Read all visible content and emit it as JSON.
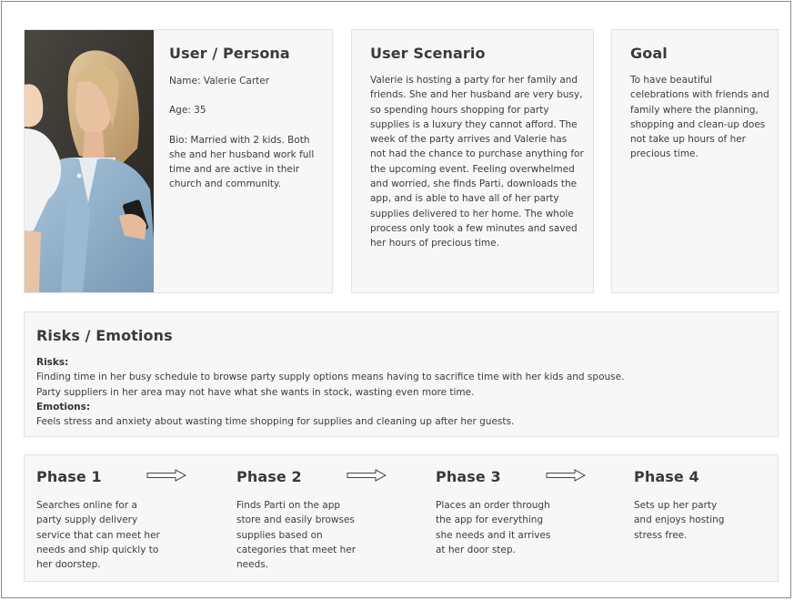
{
  "persona": {
    "title": "User / Persona",
    "name": "Name: Valerie Carter",
    "age": "Age: 35",
    "bio": "Bio: Married with 2 kids. Both she and her husband work full time and are active in their church and community."
  },
  "scenario": {
    "title": "User Scenario",
    "text": "Valerie is hosting a party for her family and friends. She and her husband are very busy, so spending hours shopping for party supplies is a luxury they cannot afford. The week of the party arrives and Valerie has not had the chance to purchase anything for the upcoming event. Feeling overwhelmed and worried, she finds Parti, downloads the app, and is able to have all of her party supplies delivered to her home. The whole process only took a few minutes and saved her hours of precious time."
  },
  "goal": {
    "title": "Goal",
    "text": "To have beautiful celebrations with friends and family where the planning, shopping and clean-up does not take up hours of her precious time."
  },
  "risks": {
    "title": "Risks / Emotions",
    "risks_label": "Risks:",
    "risk_1": "Finding time in her busy schedule to browse party supply options means having to sacrifice time with her kids and spouse.",
    "risk_2": "Party suppliers in her area may not have what she wants in stock, wasting even more time.",
    "emotions_label": "Emotions:",
    "emotion_1": "Feels stress and anxiety about wasting time shopping for supplies and cleaning up after her guests."
  },
  "phases": [
    {
      "title": "Phase 1",
      "text": "Searches online for a party supply delivery service that can meet her needs and ship quickly to her doorstep."
    },
    {
      "title": "Phase 2",
      "text": "Finds Parti on the app store and easily browses supplies based on categories that meet her needs."
    },
    {
      "title": "Phase 3",
      "text": "Places an order through the app for everything she needs and it arrives at her door step."
    },
    {
      "title": "Phase 4",
      "text": "Sets up her party and enjoys hosting stress free."
    }
  ],
  "icons": {
    "arrow": "right-arrow-icon"
  },
  "colors": {
    "card_bg": "#f7f7f7",
    "border": "#e2e2e2",
    "frame": "#8a8a8a",
    "jacket": "#8fb2cc"
  }
}
